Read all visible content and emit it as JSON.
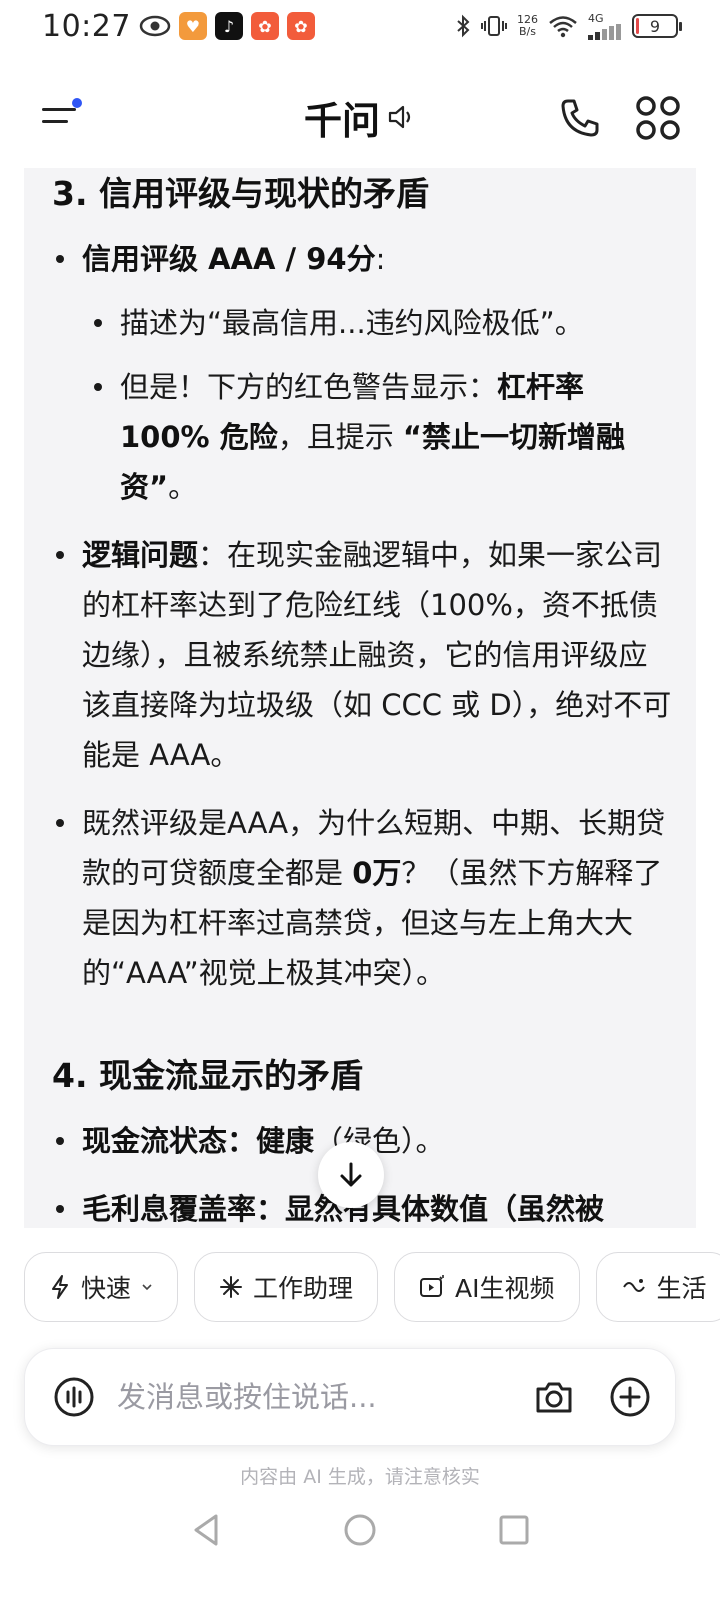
{
  "status_bar": {
    "time": "10:27",
    "net_speed_value": "126",
    "net_speed_unit": "B/s",
    "network": "4G",
    "battery": "9",
    "battery_level_percent": 9,
    "app_icons": [
      "eye-icon",
      "heart-app-icon",
      "tiktok-icon",
      "kuaishou-icon",
      "kuaishou-icon"
    ],
    "battery_color": "#e34a4a"
  },
  "header": {
    "title": "千问"
  },
  "content": {
    "section3": {
      "title": "3. 信用评级与现状的矛盾",
      "b1_bold": "信用评级 AAA / 94分",
      "b1_rest": ":",
      "b1_sub1": "描述为“最高信用...违约风险极低”。",
      "b1_sub2_a": "但是！下方的红色警告显示：",
      "b1_sub2_bold1": "杠杆率 100% 危险",
      "b1_sub2_b": "，且提示 ",
      "b1_sub2_bold2": "“禁止一切新增融资”",
      "b1_sub2_c": "。",
      "b2_bold": "逻辑问题",
      "b2_rest": "：在现实金融逻辑中，如果一家公司的杠杆率达到了危险红线（100%，资不抵债边缘），且被系统禁止融资，它的信用评级应该直接降为垃圾级（如 CCC 或 D），绝对不可能是 AAA。",
      "b3_a": "既然评级是AAA，为什么短期、中期、长期贷款的可贷额度全都是 ",
      "b3_bold": "0万",
      "b3_b": "？（虽然下方解释了是因为杠杆率过高禁贷，但这与左上角大大的“AAA”视觉上极其冲突）。"
    },
    "section4": {
      "title": "4. 现金流显示的矛盾",
      "b1_bold": "现金流状态：健康",
      "b1_rest": "（绿色）。",
      "b2_partial": "毛利息覆盖率：显然有具体数值（虽然被"
    }
  },
  "chips": [
    {
      "icon": "lightning-icon",
      "label": "快速",
      "has_dropdown": true
    },
    {
      "icon": "sparkle-icon",
      "label": "工作助理"
    },
    {
      "icon": "video-icon",
      "label": "AI生视频"
    },
    {
      "icon": "life-icon",
      "label": "生活"
    }
  ],
  "input": {
    "placeholder": "发消息或按住说话..."
  },
  "disclaimer": "内容由 AI 生成，请注意核实",
  "colors": {
    "accent_dot": "#2f56f5",
    "card_bg": "#f4f4f6"
  }
}
